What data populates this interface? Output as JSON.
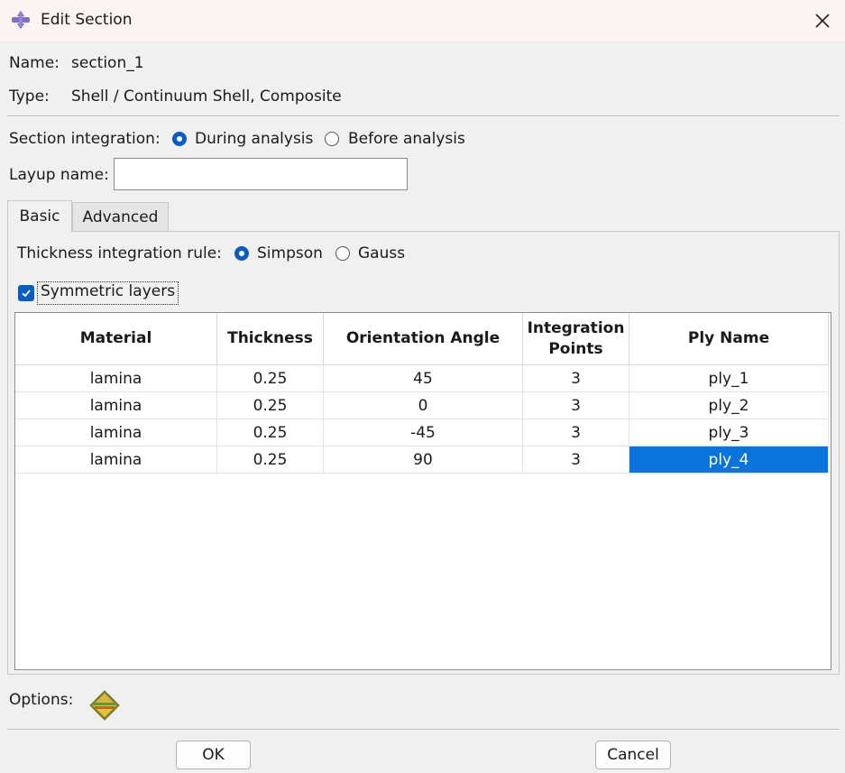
{
  "window": {
    "title": "Edit Section",
    "title_icon": "section-icon",
    "close_icon": "close-icon"
  },
  "info": {
    "name_label": "Name:",
    "name_value": "section_1",
    "type_label": "Type:",
    "type_value": "Shell / Continuum Shell, Composite"
  },
  "integration": {
    "label": "Section integration:",
    "options": [
      {
        "label": "During analysis",
        "selected": true
      },
      {
        "label": "Before analysis",
        "selected": false
      }
    ]
  },
  "layup": {
    "label": "Layup name:",
    "value": "",
    "placeholder": ""
  },
  "tabs": [
    {
      "label": "Basic",
      "active": true
    },
    {
      "label": "Advanced",
      "active": false
    }
  ],
  "thickness_rule": {
    "label": "Thickness integration rule:",
    "options": [
      {
        "label": "Simpson",
        "selected": true
      },
      {
        "label": "Gauss",
        "selected": false
      }
    ]
  },
  "symmetric": {
    "label": "Symmetric layers",
    "checked": true
  },
  "table": {
    "headers": [
      "Material",
      "Thickness",
      "Orientation Angle",
      "Integration Points",
      "Ply Name"
    ],
    "rows": [
      [
        "lamina",
        "0.25",
        "45",
        "3",
        "ply_1"
      ],
      [
        "lamina",
        "0.25",
        "0",
        "3",
        "ply_2"
      ],
      [
        "lamina",
        "0.25",
        "-45",
        "3",
        "ply_3"
      ],
      [
        "lamina",
        "0.25",
        "90",
        "3",
        "ply_4"
      ]
    ],
    "selected_cell": {
      "row": 3,
      "col": 4
    }
  },
  "options": {
    "label": "Options:",
    "icon": "layup-options-icon"
  },
  "buttons": {
    "ok": "OK",
    "cancel": "Cancel"
  },
  "colors": {
    "accent": "#0a5cc0",
    "selection": "#0a74da"
  }
}
